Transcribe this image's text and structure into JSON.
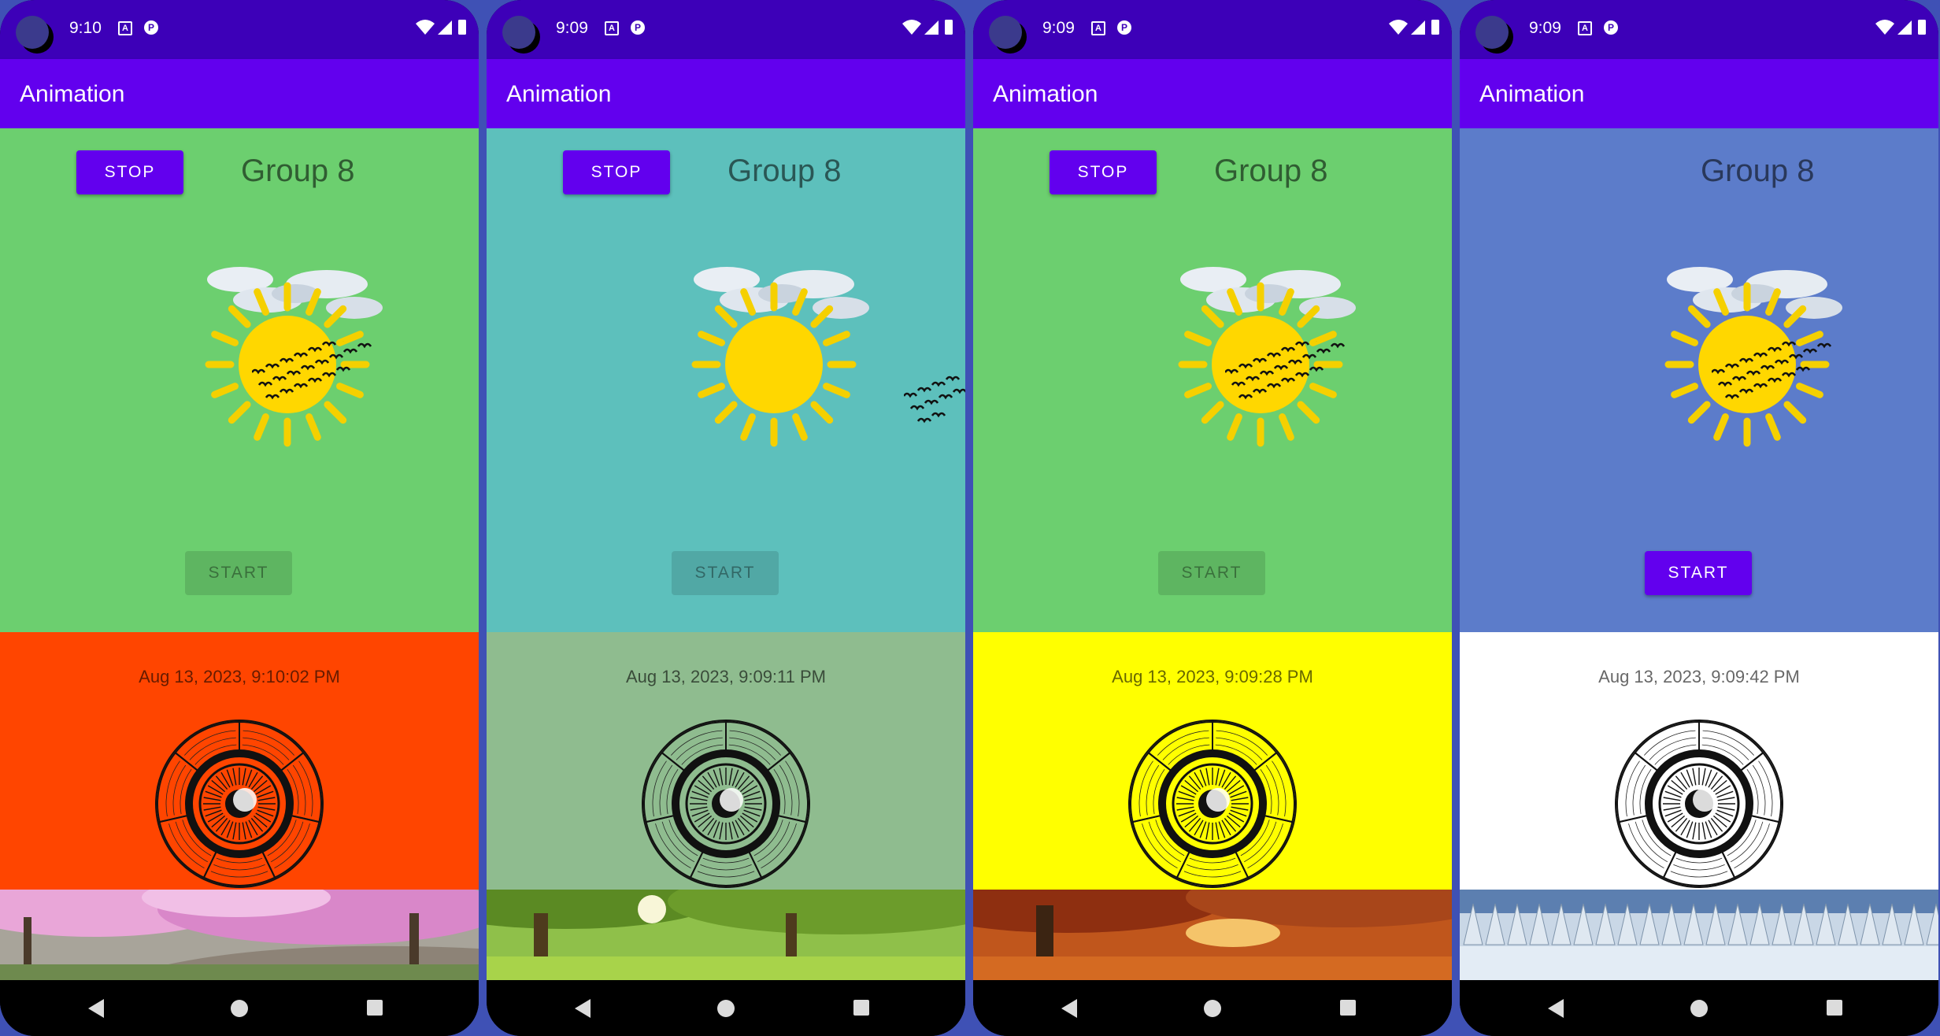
{
  "screens": [
    {
      "time": "9:10",
      "app_title": "Animation",
      "stop_label": "STOP",
      "show_stop": true,
      "group_label": "Group 8",
      "start_label": "START",
      "start_enabled": false,
      "top_color": "#6ccf6f",
      "date_text": "Aug 13, 2023, 9:10:02 PM",
      "mid_color": "#ff4500",
      "wheel_days": [
        "SATURDAY",
        "SUNDAY",
        "MONDAY",
        "TUESDAY",
        "WEDNESDAY",
        "THURSDAY",
        "FRIDAY"
      ],
      "banner": "spring-cherry-blossom",
      "birds_position": "over-sun"
    },
    {
      "time": "9:09",
      "app_title": "Animation",
      "stop_label": "STOP",
      "show_stop": true,
      "group_label": "Group 8",
      "start_label": "START",
      "start_enabled": false,
      "top_color": "#5dc0bc",
      "date_text": "Aug 13, 2023, 9:09:11 PM",
      "mid_color": "#8fbc8f",
      "wheel_days": [
        "MONDAY",
        "TUESDAY",
        "WEDNESDAY",
        "THURSDAY",
        "FRIDAY",
        "SATURDAY",
        "SUNDAY"
      ],
      "banner": "summer-green-park",
      "birds_position": "right-edge"
    },
    {
      "time": "9:09",
      "app_title": "Animation",
      "stop_label": "STOP",
      "show_stop": true,
      "group_label": "Group 8",
      "start_label": "START",
      "start_enabled": false,
      "top_color": "#6ccf6f",
      "date_text": "Aug 13, 2023, 9:09:28 PM",
      "mid_color": "#ffff00",
      "wheel_days": [
        "SATURDAY",
        "SUNDAY",
        "MONDAY",
        "TUESDAY",
        "WEDNESDAY",
        "THURSDAY",
        "FRIDAY"
      ],
      "banner": "autumn-leaves",
      "birds_position": "over-sun"
    },
    {
      "time": "9:09",
      "app_title": "Animation",
      "stop_label": "STOP",
      "show_stop": false,
      "group_label": "Group 8",
      "start_label": "START",
      "start_enabled": true,
      "top_color": "#5c7cca",
      "date_text": "Aug 13, 2023, 9:09:42 PM",
      "mid_color": "#ffffff",
      "wheel_days": [
        "SATURDAY",
        "SUNDAY",
        "MONDAY",
        "TUESDAY",
        "WEDNESDAY",
        "THURSDAY",
        "FRIDAY"
      ],
      "banner": "winter-snow-forest",
      "birds_position": "over-sun"
    }
  ],
  "icons": {
    "status": [
      "camera-cutout-icon",
      "notification-a-icon",
      "notification-p-icon",
      "wifi-icon",
      "signal-icon",
      "battery-icon"
    ],
    "nav": [
      "back-icon",
      "home-icon",
      "recents-icon"
    ]
  }
}
